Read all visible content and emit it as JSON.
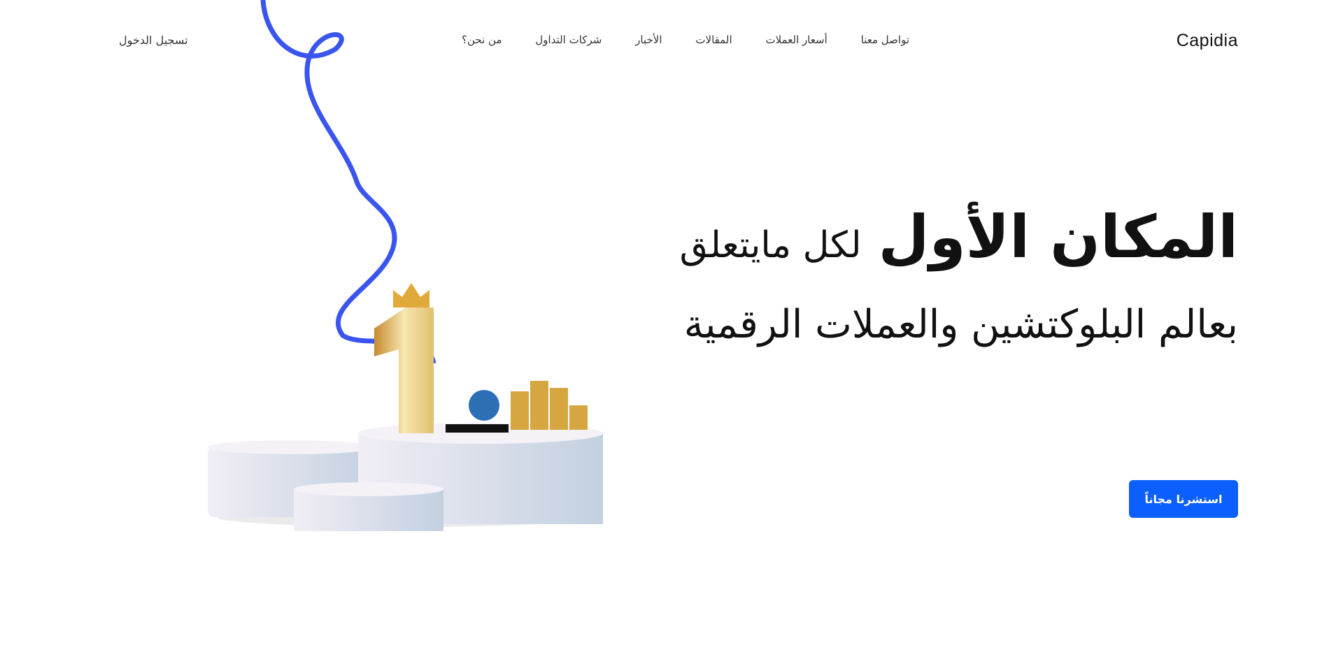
{
  "header": {
    "logo": "Capidia",
    "nav": [
      "من نحن؟",
      "شركات التداول",
      "الأخبار",
      "المقالات",
      "أسعار العملات",
      "تواصل معنا"
    ],
    "login": "تسجيل الدخول"
  },
  "hero": {
    "title_bold": "المكان الأول",
    "title_light": "لكل مايتعلق",
    "subtitle": "بعالم البلوكتشين والعملات الرقمية",
    "cta": "استشرنا مجاناً",
    "cta_color": "#0a5ffe"
  }
}
